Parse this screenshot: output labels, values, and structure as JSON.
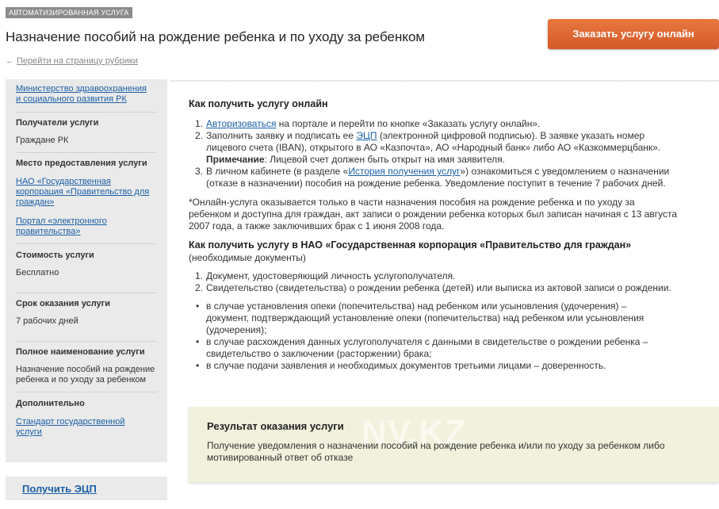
{
  "header": {
    "tag": "АВТОМАТИЗИРОВАННАЯ УСЛУГА",
    "title": "Назначение пособий на рождение ребенка и по уходу за ребенком",
    "order_button": "Заказать услугу онлайн",
    "back_arrow": "←",
    "back_link": "Перейти на страницу рубрики"
  },
  "sidebar": {
    "ministry_line1": "Министерство здравоохранения",
    "ministry_line2": "и социального развития РК",
    "recipients_head": "Получатели услуги",
    "recipients_text": "Граждане РК",
    "place_head": "Место предоставления услуги",
    "place_link1_line1": "НАО «Государственная",
    "place_link1_line2": "корпорация «Правительство для",
    "place_link1_line3": "граждан»",
    "place_link2_line1": "Портал «электронного",
    "place_link2_line2": "правительства»",
    "cost_head": "Стоимость услуги",
    "cost_text": "Бесплатно",
    "term_head": "Срок оказания услуги",
    "term_text": "7 рабочих дней",
    "fullname_head": "Полное наименование услуги",
    "fullname_line1": "Назначение пособий на рождение",
    "fullname_line2": "ребенка и по уходу за ребенком",
    "extra_head": "Дополнительно",
    "extra_link_line1": "Стандарт государственной",
    "extra_link_line2": "услуги",
    "ecp_link": "Получить ЭЦП"
  },
  "online": {
    "heading": "Как получить услугу онлайн",
    "step1_num": "1.",
    "step1_link": "Авторизоваться",
    "step1_text": " на портале и перейти по кнопке «Заказать услугу онлайн».",
    "step2_num": "2.",
    "step2_a": "Заполнить заявку и подписать ее ",
    "step2_link": "ЭЦП",
    "step2_b": " (электронной цифровой подписью). В заявке указать номер",
    "step2_line2": "лицевого счета (IBAN), открытого в АО «Казпочта», АО «Народный банк» либо АО «Казкоммерцбанк».",
    "step2_note_label": "Примечание",
    "step2_note_text": ": Лицевой счет должен быть открыт на имя заявителя.",
    "step3_num": "3.",
    "step3_a": "В личном кабинете (в разделе «",
    "step3_link": "История получения услуг",
    "step3_b": "») ознакомиться с уведомлением о назначении",
    "step3_line2": "(отказе в назначении) пособия на рождение ребенка. Уведомление поступит в течение 7 рабочих дней.",
    "footnote_line1": "*Онлайн-услуга оказывается только в части назначения пособия на рождение ребенка и по уходу за",
    "footnote_line2": "ребенком и доступна для граждан, акт записи о рождении ребенка которых был записан начиная с 13 августа",
    "footnote_line3": "2007 года, а также заключивших брак с 1 июня 2008 года."
  },
  "nao": {
    "heading": "Как получить услугу в НАО «Государственная корпорация «Правительство для граждан»",
    "subheading": "(необходимые документы)",
    "doc1_num": "1.",
    "doc1": "Документ, удостоверяющий личность услугополучателя.",
    "doc2_num": "2.",
    "doc2": "Свидетельство (свидетельства) о рождении ребенка (детей) или выписка из актовой записи о рождении.",
    "bullet_char": "•",
    "b1_line1": "в случае установления опеки (попечительства) над ребенком или усыновления (удочерения) –",
    "b1_line2": "документ, подтверждающий установление опеки (попечительства) над ребенком или усыновления",
    "b1_line3": "(удочерения);",
    "b2_line1": "в случае расхождения данных услугополучателя с данными в свидетельстве о рождении ребенка –",
    "b2_line2": "свидетельство о заключении (расторжении) брака;",
    "b3_line1": "в случае подачи заявления и необходимых документов третьими лицами – доверенность."
  },
  "result": {
    "title": "Результат оказания услуги",
    "line1": "Получение уведомления о назначении пособий на рождение ребенка и/или по уходу за ребенком либо",
    "line2": "мотивированный ответ об отказе",
    "watermark": "NV.KZ"
  }
}
